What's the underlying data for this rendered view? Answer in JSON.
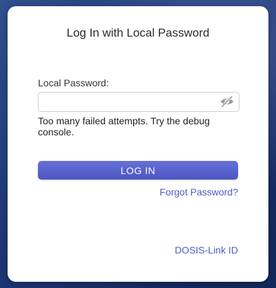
{
  "login": {
    "title": "Log In with Local Password",
    "password_label": "Local Password:",
    "password_value": "",
    "password_placeholder": "",
    "toggle_icon": "eye-slash-icon",
    "error_message": "Too many failed attempts. Try the debug console.",
    "submit_label": "LOG IN",
    "forgot_label": "Forgot Password?",
    "id_link_label": "DOSIS-Link ID"
  },
  "colors": {
    "accent": "#5560cc",
    "link": "#4e5bc9",
    "background": "#1f3978"
  }
}
